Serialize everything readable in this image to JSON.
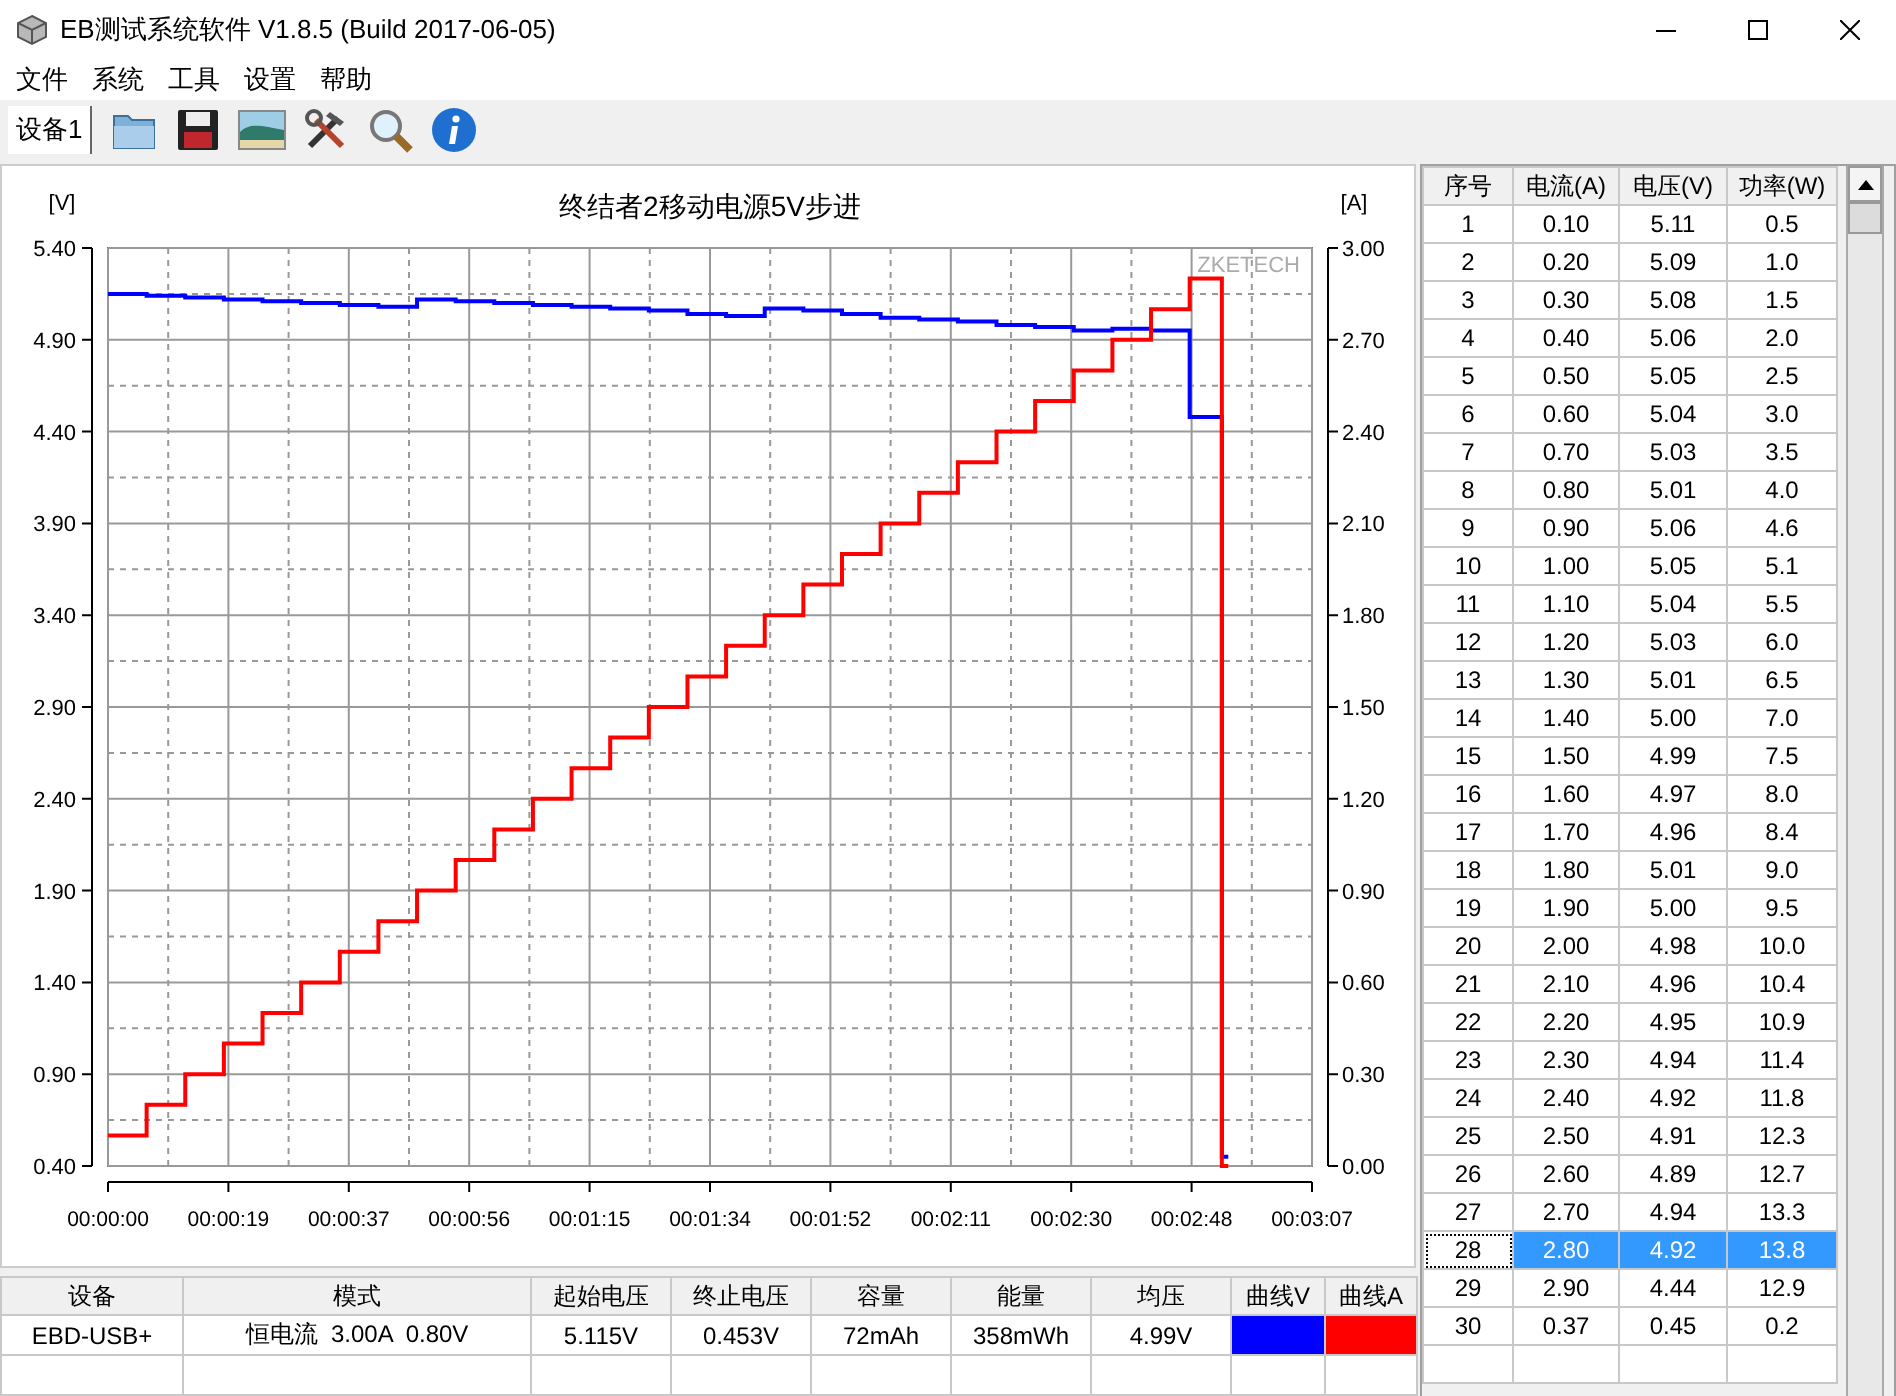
{
  "window": {
    "title": "EB测试系统软件 V1.8.5 (Build 2017-06-05)"
  },
  "menu": [
    "文件",
    "系统",
    "工具",
    "设置",
    "帮助"
  ],
  "toolbar": {
    "device_tab": {
      "label": "设备1",
      "selected": true
    }
  },
  "chart": {
    "watermark": "ZKETECH",
    "chart_data": {
      "type": "line",
      "title": "终结者2移动电源5V步进",
      "ylabel": "[V]",
      "y2label": "[A]",
      "grid": true,
      "x": [
        0,
        6,
        6,
        12,
        12,
        18,
        18,
        24,
        24,
        30,
        30,
        36,
        36,
        42,
        42,
        48,
        48,
        54,
        54,
        60,
        60,
        66,
        66,
        72,
        72,
        78,
        78,
        84,
        84,
        90,
        90,
        96,
        96,
        102,
        102,
        108,
        108,
        114,
        114,
        120,
        120,
        126,
        126,
        132,
        132,
        138,
        138,
        144,
        144,
        150,
        150,
        156,
        156,
        162,
        162,
        168,
        168,
        173,
        173,
        174
      ],
      "xlim": [
        0,
        187
      ],
      "xticks": [
        {
          "value": 0,
          "label": "00:00:00"
        },
        {
          "value": 18.7,
          "label": "00:00:19"
        },
        {
          "value": 37.4,
          "label": "00:00:37"
        },
        {
          "value": 56.1,
          "label": "00:00:56"
        },
        {
          "value": 74.8,
          "label": "00:01:15"
        },
        {
          "value": 93.5,
          "label": "00:01:34"
        },
        {
          "value": 112.2,
          "label": "00:01:52"
        },
        {
          "value": 130.9,
          "label": "00:02:11"
        },
        {
          "value": 149.6,
          "label": "00:02:30"
        },
        {
          "value": 168.3,
          "label": "00:02:48"
        },
        {
          "value": 187,
          "label": "00:03:07"
        }
      ],
      "ylim": [
        0.4,
        5.4
      ],
      "yticks": [
        {
          "value": 0.4,
          "label": "0.40"
        },
        {
          "value": 0.9,
          "label": "0.90"
        },
        {
          "value": 1.4,
          "label": "1.40"
        },
        {
          "value": 1.9,
          "label": "1.90"
        },
        {
          "value": 2.4,
          "label": "2.40"
        },
        {
          "value": 2.9,
          "label": "2.90"
        },
        {
          "value": 3.4,
          "label": "3.40"
        },
        {
          "value": 3.9,
          "label": "3.90"
        },
        {
          "value": 4.4,
          "label": "4.40"
        },
        {
          "value": 4.9,
          "label": "4.90"
        },
        {
          "value": 5.4,
          "label": "5.40"
        }
      ],
      "y2lim": [
        0,
        3
      ],
      "y2ticks": [
        {
          "value": 0,
          "label": "0.00"
        },
        {
          "value": 0.3,
          "label": "0.30"
        },
        {
          "value": 0.6,
          "label": "0.60"
        },
        {
          "value": 0.9,
          "label": "0.90"
        },
        {
          "value": 1.2,
          "label": "1.20"
        },
        {
          "value": 1.5,
          "label": "1.50"
        },
        {
          "value": 1.8,
          "label": "1.80"
        },
        {
          "value": 2.1,
          "label": "2.10"
        },
        {
          "value": 2.4,
          "label": "2.40"
        },
        {
          "value": 2.7,
          "label": "2.70"
        },
        {
          "value": 3.0,
          "label": "3.00"
        }
      ],
      "series": [
        {
          "color": "#0000ff",
          "values": [
            5.15,
            5.15,
            5.14,
            5.14,
            5.13,
            5.13,
            5.12,
            5.12,
            5.11,
            5.11,
            5.1,
            5.1,
            5.09,
            5.09,
            5.08,
            5.08,
            5.12,
            5.12,
            5.11,
            5.11,
            5.1,
            5.1,
            5.09,
            5.09,
            5.08,
            5.08,
            5.07,
            5.07,
            5.06,
            5.06,
            5.04,
            5.04,
            5.03,
            5.03,
            5.07,
            5.07,
            5.06,
            5.06,
            5.04,
            5.04,
            5.02,
            5.02,
            5.01,
            5.01,
            5.0,
            5.0,
            4.98,
            4.98,
            4.97,
            4.97,
            4.95,
            4.95,
            4.96,
            4.96,
            4.95,
            4.95,
            4.48,
            4.48,
            0.45,
            0.45
          ]
        },
        {
          "color": "#ff0000",
          "axis": "y2",
          "values": [
            0.1,
            0.1,
            0.2,
            0.2,
            0.3,
            0.3,
            0.4,
            0.4,
            0.5,
            0.5,
            0.6,
            0.6,
            0.7,
            0.7,
            0.8,
            0.8,
            0.9,
            0.9,
            1.0,
            1.0,
            1.1,
            1.1,
            1.2,
            1.2,
            1.3,
            1.3,
            1.4,
            1.4,
            1.5,
            1.5,
            1.6,
            1.6,
            1.7,
            1.7,
            1.8,
            1.8,
            1.9,
            1.9,
            2.0,
            2.0,
            2.1,
            2.1,
            2.2,
            2.2,
            2.3,
            2.3,
            2.4,
            2.4,
            2.5,
            2.5,
            2.6,
            2.6,
            2.7,
            2.7,
            2.8,
            2.8,
            2.9,
            2.9,
            0.0,
            0.0
          ]
        }
      ]
    }
  },
  "readings_table": {
    "columns": [
      "序号",
      "电流(A)",
      "电压(V)",
      "功率(W)"
    ],
    "rows": [
      {
        "cells": [
          "1",
          "0.10",
          "5.11",
          "0.5"
        ],
        "selected": false
      },
      {
        "cells": [
          "2",
          "0.20",
          "5.09",
          "1.0"
        ],
        "selected": false
      },
      {
        "cells": [
          "3",
          "0.30",
          "5.08",
          "1.5"
        ],
        "selected": false
      },
      {
        "cells": [
          "4",
          "0.40",
          "5.06",
          "2.0"
        ],
        "selected": false
      },
      {
        "cells": [
          "5",
          "0.50",
          "5.05",
          "2.5"
        ],
        "selected": false
      },
      {
        "cells": [
          "6",
          "0.60",
          "5.04",
          "3.0"
        ],
        "selected": false
      },
      {
        "cells": [
          "7",
          "0.70",
          "5.03",
          "3.5"
        ],
        "selected": false
      },
      {
        "cells": [
          "8",
          "0.80",
          "5.01",
          "4.0"
        ],
        "selected": false
      },
      {
        "cells": [
          "9",
          "0.90",
          "5.06",
          "4.6"
        ],
        "selected": false
      },
      {
        "cells": [
          "10",
          "1.00",
          "5.05",
          "5.1"
        ],
        "selected": false
      },
      {
        "cells": [
          "11",
          "1.10",
          "5.04",
          "5.5"
        ],
        "selected": false
      },
      {
        "cells": [
          "12",
          "1.20",
          "5.03",
          "6.0"
        ],
        "selected": false
      },
      {
        "cells": [
          "13",
          "1.30",
          "5.01",
          "6.5"
        ],
        "selected": false
      },
      {
        "cells": [
          "14",
          "1.40",
          "5.00",
          "7.0"
        ],
        "selected": false
      },
      {
        "cells": [
          "15",
          "1.50",
          "4.99",
          "7.5"
        ],
        "selected": false
      },
      {
        "cells": [
          "16",
          "1.60",
          "4.97",
          "8.0"
        ],
        "selected": false
      },
      {
        "cells": [
          "17",
          "1.70",
          "4.96",
          "8.4"
        ],
        "selected": false
      },
      {
        "cells": [
          "18",
          "1.80",
          "5.01",
          "9.0"
        ],
        "selected": false
      },
      {
        "cells": [
          "19",
          "1.90",
          "5.00",
          "9.5"
        ],
        "selected": false
      },
      {
        "cells": [
          "20",
          "2.00",
          "4.98",
          "10.0"
        ],
        "selected": false
      },
      {
        "cells": [
          "21",
          "2.10",
          "4.96",
          "10.4"
        ],
        "selected": false
      },
      {
        "cells": [
          "22",
          "2.20",
          "4.95",
          "10.9"
        ],
        "selected": false
      },
      {
        "cells": [
          "23",
          "2.30",
          "4.94",
          "11.4"
        ],
        "selected": false
      },
      {
        "cells": [
          "24",
          "2.40",
          "4.92",
          "11.8"
        ],
        "selected": false
      },
      {
        "cells": [
          "25",
          "2.50",
          "4.91",
          "12.3"
        ],
        "selected": false
      },
      {
        "cells": [
          "26",
          "2.60",
          "4.89",
          "12.7"
        ],
        "selected": false
      },
      {
        "cells": [
          "27",
          "2.70",
          "4.94",
          "13.3"
        ],
        "selected": false
      },
      {
        "cells": [
          "28",
          "2.80",
          "4.92",
          "13.8"
        ],
        "selected": true
      },
      {
        "cells": [
          "29",
          "2.90",
          "4.44",
          "12.9"
        ],
        "selected": false
      },
      {
        "cells": [
          "30",
          "0.37",
          "0.45",
          "0.2"
        ],
        "selected": false
      }
    ]
  },
  "summary_table": {
    "columns": [
      "设备",
      "模式",
      "起始电压",
      "终止电压",
      "容量",
      "能量",
      "均压",
      "曲线V",
      "曲线A"
    ],
    "rows": [
      {
        "cells": [
          "EBD-USB+",
          "恒电流  3.00A  0.80V",
          "5.115V",
          "0.453V",
          "72mAh",
          "358mWh",
          "4.99V"
        ],
        "curves": [
          {
            "color": "#0000ff"
          },
          {
            "color": "#ff0000"
          }
        ]
      }
    ]
  }
}
